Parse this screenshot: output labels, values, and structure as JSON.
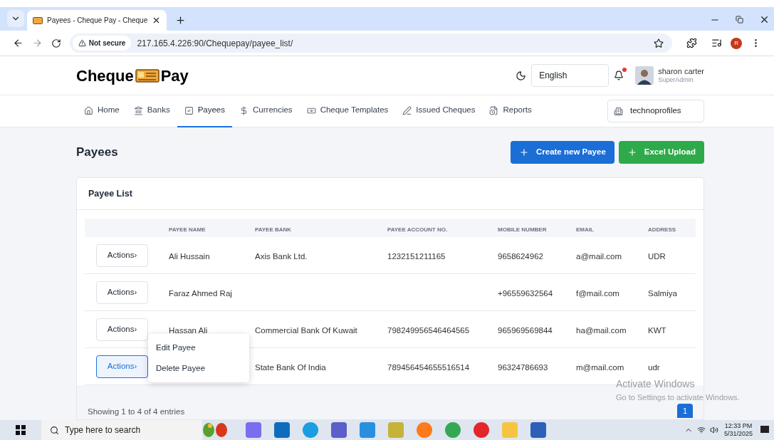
{
  "browser": {
    "tabs": [
      {
        "title": "Payees - Cheque Pay - Cheque",
        "selected": true
      }
    ],
    "security_label": "Not secure",
    "url": "217.165.4.226:90/Chequepay/payee_list/",
    "profile_initial": "R"
  },
  "header": {
    "logo_left": "Cheque",
    "logo_right": "Pay",
    "language": "English",
    "has_notification": true,
    "user_name": "sharon carter",
    "user_role": "SuperAdmin"
  },
  "nav": {
    "items": [
      {
        "label": "Home",
        "selected": false
      },
      {
        "label": "Banks",
        "selected": false
      },
      {
        "label": "Payees",
        "selected": true
      },
      {
        "label": "Currencies",
        "selected": false
      },
      {
        "label": "Cheque Templates",
        "selected": false
      },
      {
        "label": "Issued Cheques",
        "selected": false
      },
      {
        "label": "Reports",
        "selected": false
      }
    ],
    "organization": "technoprofiles"
  },
  "page": {
    "title": "Payees",
    "buttons": [
      {
        "label": "Create new Payee",
        "kind": "primary"
      },
      {
        "label": "Excel Upload",
        "kind": "success"
      }
    ]
  },
  "table": {
    "title": "Payee List",
    "columns": [
      "PAYEE NAME",
      "PAYEE BANK",
      "PAYEE ACCOUNT NO.",
      "MOBILE NUMBER",
      "EMAIL",
      "ADDRESS"
    ],
    "rows": [
      {
        "action": "Actions›",
        "active": false,
        "cells": [
          "Ali Hussain",
          "Axis Bank Ltd.",
          "1232151211165",
          "9658624962",
          "a@mail.com",
          "UDR"
        ]
      },
      {
        "action": "Actions›",
        "active": false,
        "cells": [
          "Faraz Ahmed Raj",
          null,
          null,
          "+96559632564",
          "f@mail.com",
          "Salmiya"
        ]
      },
      {
        "action": "Actions›",
        "active": false,
        "cells": [
          "Hassan Ali",
          "Commercial Bank Of Kuwait",
          "798249956546464565",
          "965969569844",
          "ha@mail.com",
          "KWT"
        ]
      },
      {
        "action": "Actions›",
        "active": true,
        "cells": [
          null,
          "State Bank Of India",
          "789456454655516514",
          "96324786693",
          "m@mail.com",
          "udr"
        ]
      }
    ],
    "menu": [
      "Edit Payee",
      "Delete Payee"
    ],
    "footer": "Showing 1 to 4 of 4 entries",
    "pages": [
      {
        "label": "1",
        "selected": true
      }
    ]
  },
  "activation": {
    "title": "Activate Windows",
    "subtitle": "Go to Settings to activate Windows."
  },
  "taskbar": {
    "search_placeholder": "Type here to search",
    "time": "12:33 PM",
    "date": "5/31/2025"
  }
}
